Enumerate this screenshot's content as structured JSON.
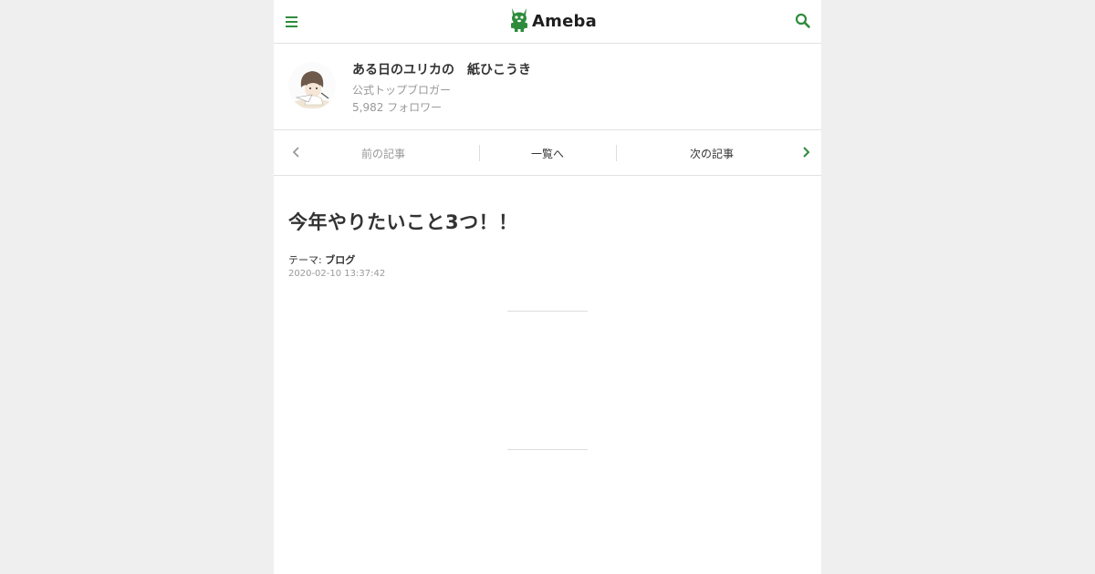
{
  "header": {
    "logo_text": "Ameba",
    "brand_color": "#2d8c3c",
    "menu_icon": "hamburger-menu-icon",
    "search_icon": "search-icon"
  },
  "profile": {
    "blog_title": "ある日のユリカの　紙ひこうき",
    "blogger_type": "公式トップブロガー",
    "followers": "5,982 フォロワー"
  },
  "article_nav": {
    "prev_label": "前の記事",
    "list_label": "一覧へ",
    "next_label": "次の記事"
  },
  "article": {
    "title": "今年やりたいこと3つ！！",
    "theme_label": "テーマ:",
    "theme_value": "ブログ",
    "date": "2020-02-10 13:37:42"
  }
}
